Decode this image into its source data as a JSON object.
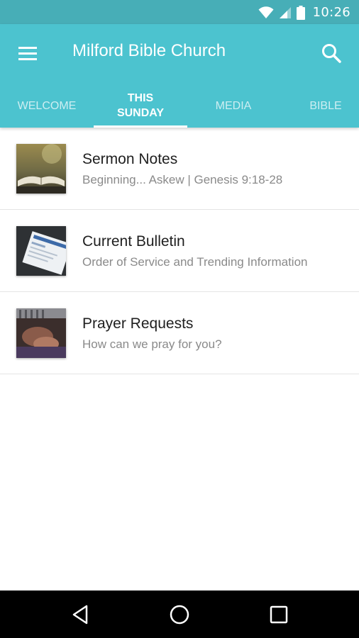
{
  "status_bar": {
    "time": "10:26"
  },
  "app_bar": {
    "title": "Milford Bible Church"
  },
  "tabs": [
    {
      "label": "WELCOME"
    },
    {
      "label": "THIS SUNDAY",
      "active": true
    },
    {
      "label": "MEDIA"
    },
    {
      "label": "BIBLE"
    }
  ],
  "items": [
    {
      "title": "Sermon Notes",
      "subtitle": "Beginning... Askew | Genesis 9:18-28",
      "icon": "open-bible-thumbnail"
    },
    {
      "title": "Current Bulletin",
      "subtitle": "Order of Service and Trending Information",
      "icon": "bulletin-thumbnail"
    },
    {
      "title": "Prayer Requests",
      "subtitle": "How can we pray for you?",
      "icon": "praying-hands-thumbnail"
    }
  ],
  "colors": {
    "status_bar": "#47aeb7",
    "app_bar": "#4cc3cf",
    "title_text": "#1f1f1f",
    "subtitle_text": "#8a8a8a"
  }
}
